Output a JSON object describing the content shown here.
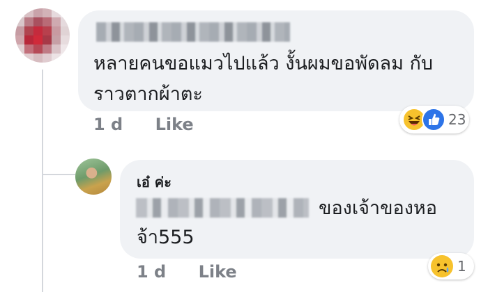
{
  "comment": {
    "text": "หลายคนขอแมวไปแล้ว งั้นผมขอพัดลม กับราวตากผ้าตะ",
    "time": "1 d",
    "like_label": "Like",
    "reactions": {
      "icons": [
        "haha-icon",
        "like-icon"
      ],
      "count": "23"
    }
  },
  "reply": {
    "author": "เอ๋ ค่ะ",
    "text_line1": "ของเจ้าของหอ",
    "text_line2": "จ้า555",
    "time": "1 d",
    "like_label": "Like",
    "reactions": {
      "icons": [
        "sad-icon"
      ],
      "count": "1"
    }
  },
  "colors": {
    "bubble": "#f0f2f5",
    "meta_text": "#7d8188",
    "like_blue": "#2d74e8",
    "emoji_yellow": "#f7c22d"
  }
}
